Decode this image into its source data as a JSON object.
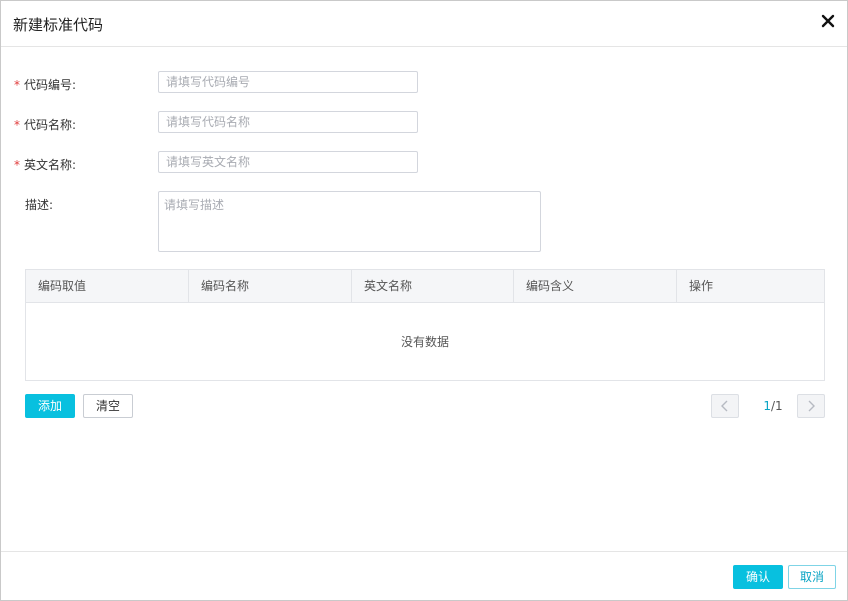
{
  "dialog": {
    "title": "新建标准代码"
  },
  "form": {
    "code_number": {
      "required_mark": "*",
      "label": "代码编号:",
      "placeholder": "请填写代码编号"
    },
    "code_name": {
      "required_mark": "*",
      "label": "代码名称:",
      "placeholder": "请填写代码名称"
    },
    "english_name": {
      "required_mark": "*",
      "label": "英文名称:",
      "placeholder": "请填写英文名称"
    },
    "description": {
      "label": "描述:",
      "placeholder": "请填写描述"
    }
  },
  "table": {
    "columns": [
      "编码取值",
      "编码名称",
      "英文名称",
      "编码含义",
      "操作"
    ],
    "empty_text": "没有数据"
  },
  "actions": {
    "add_label": "添加",
    "clear_label": "清空"
  },
  "pagination": {
    "current": "1",
    "total": "/1"
  },
  "footer": {
    "confirm_label": "确认",
    "cancel_label": "取消"
  },
  "colors": {
    "accent": "#08c0df",
    "required": "#e03c3c"
  }
}
